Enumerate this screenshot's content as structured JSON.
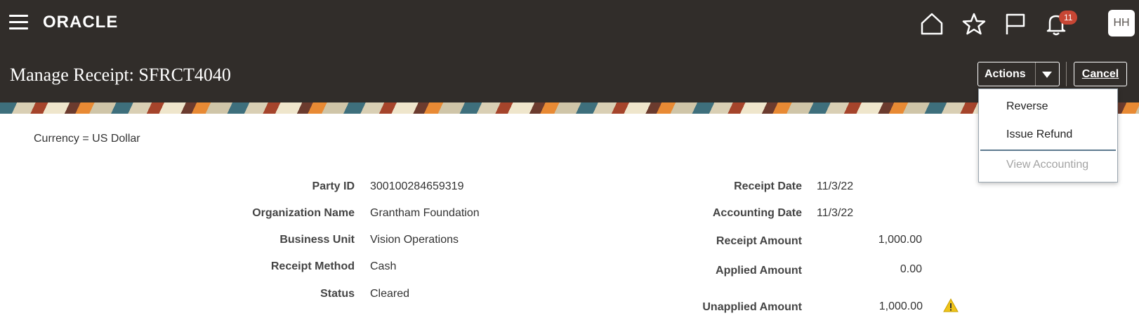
{
  "header": {
    "logo_text": "ORACLE",
    "notification_count": "11",
    "avatar_initials": "HH"
  },
  "page": {
    "title": "Manage Receipt: SFRCT4040",
    "actions_label": "Actions",
    "cancel_label": "Cancel"
  },
  "actions_menu": {
    "items": [
      {
        "label": "Reverse",
        "enabled": true
      },
      {
        "label": "Issue Refund",
        "enabled": true
      },
      {
        "label": "View Accounting",
        "enabled": false
      }
    ]
  },
  "currency": "Currency = US Dollar",
  "left_fields": [
    {
      "label": "Party ID",
      "value": "300100284659319"
    },
    {
      "label": "Organization Name",
      "value": "Grantham Foundation"
    },
    {
      "label": "Business Unit",
      "value": "Vision Operations"
    },
    {
      "label": "Receipt Method",
      "value": "Cash"
    },
    {
      "label": "Status",
      "value": "Cleared"
    }
  ],
  "right_fields": [
    {
      "label": "Receipt Date",
      "value": "11/3/22"
    },
    {
      "label": "Accounting Date",
      "value": "11/3/22"
    },
    {
      "label": "Receipt Amount",
      "value": "1,000.00"
    },
    {
      "label": "Applied Amount",
      "value": "0.00"
    },
    {
      "label": "Unapplied Amount",
      "value": "1,000.00"
    }
  ],
  "icons": {
    "menu": "hamburger-icon",
    "home": "home-icon",
    "favorites": "star-icon",
    "flag": "flag-icon",
    "notifications": "bell-icon",
    "warning": "warning-icon"
  },
  "colors": {
    "header_bg": "#312d2a",
    "badge": "#c74634",
    "warning": "#f0c419"
  }
}
